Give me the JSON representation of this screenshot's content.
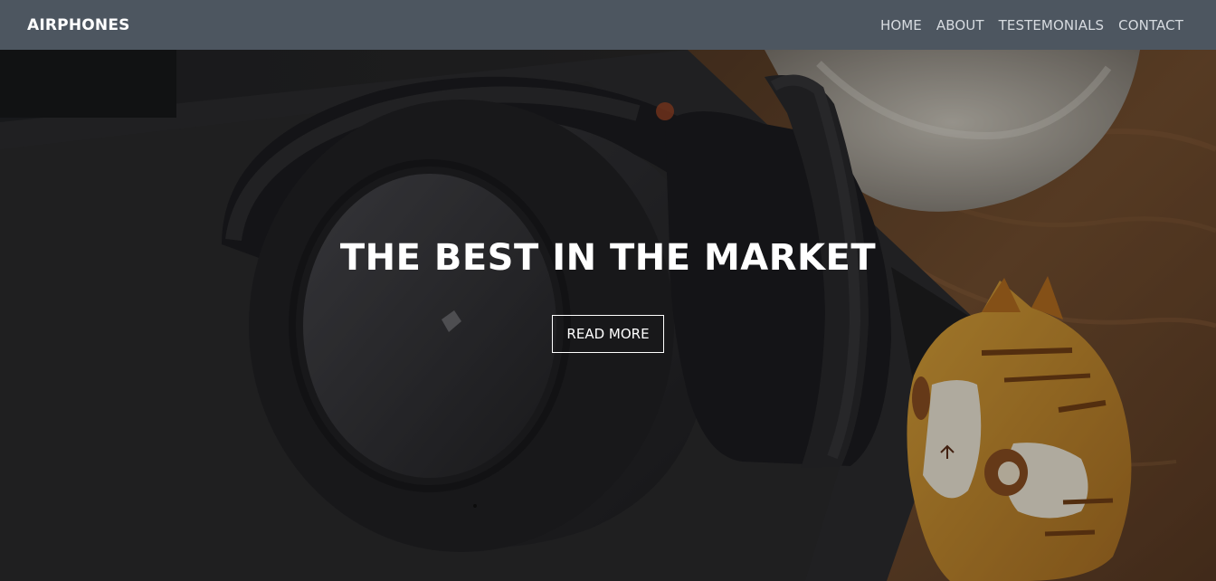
{
  "navbar": {
    "brand": "AIRPHONES",
    "links": [
      "HOME",
      "ABOUT",
      "TESTEMONIALS",
      "CONTACT"
    ]
  },
  "hero": {
    "title": "THE BEST IN THE MARKET",
    "button_label": "READ MORE"
  },
  "colors": {
    "navbar_bg": "#4d5660",
    "text": "#ffffff",
    "nav_text": "#d7dbe0"
  },
  "icons": {
    "hero_image": "headphones-photo"
  }
}
